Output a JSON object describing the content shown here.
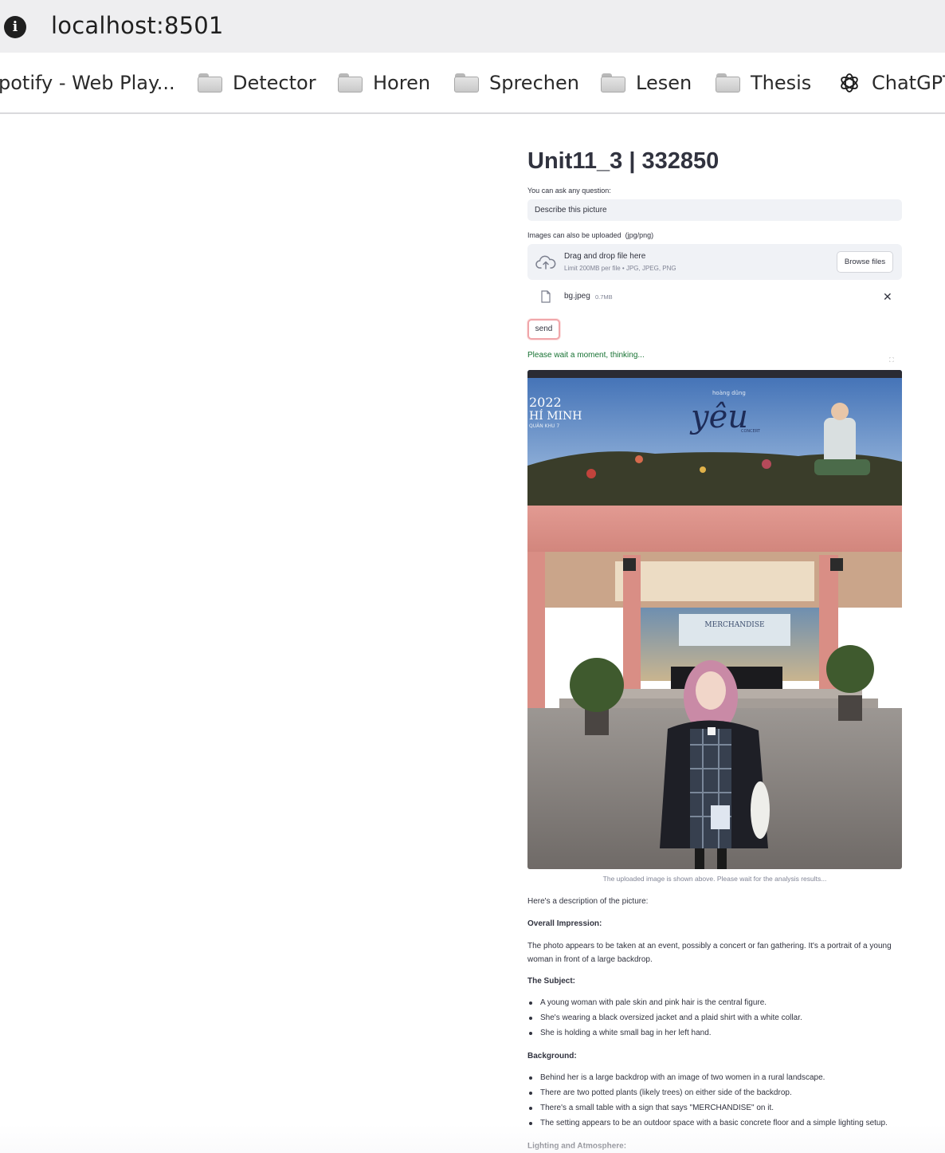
{
  "browser": {
    "url": "localhost:8501",
    "bookmarks": [
      {
        "label": "potify - Web Play...",
        "icon": "none"
      },
      {
        "label": "Detector",
        "icon": "folder-icon"
      },
      {
        "label": "Horen",
        "icon": "folder-icon"
      },
      {
        "label": "Sprechen",
        "icon": "folder-icon"
      },
      {
        "label": "Lesen",
        "icon": "folder-icon"
      },
      {
        "label": "Thesis",
        "icon": "folder-icon"
      },
      {
        "label": "ChatGPT",
        "icon": "openai-icon"
      }
    ]
  },
  "app": {
    "title": "Unit11_3 | 332850",
    "question_label": "You can ask any question:",
    "question_value": "Describe this picture",
    "upload_label": "Images can also be uploaded  (jpg/png)",
    "dropzone_title": "Drag and drop file here",
    "dropzone_limit": "Limit 200MB per file • JPG, JPEG, PNG",
    "browse_label": "Browse files",
    "file_name": "bg.jpeg",
    "file_size": "0.7MB",
    "send_label": "send",
    "status_text": "Please wait a moment, thinking...",
    "image_caption": "The uploaded image is shown above. Please wait for the analysis results...",
    "photo_text": {
      "year": "2022",
      "city": "HÍ MINH",
      "district": "QUÂN KHU 7",
      "artist": "hoàng dũng",
      "concert": "yêu",
      "subtitle": "CONCERT",
      "sign": "MERCHANDISE"
    },
    "response": {
      "intro": "Here's a description of the picture:",
      "overall_heading": "Overall Impression:",
      "overall_text": "The photo appears to be taken at an event, possibly a concert or fan gathering. It's a portrait of a young woman in front of a large backdrop.",
      "subject_heading": "The Subject:",
      "subject_items": [
        "A young woman with pale skin and pink hair is the central figure.",
        "She's wearing a black oversized jacket and a plaid shirt with a white collar.",
        "She is holding a white small bag in her left hand."
      ],
      "background_heading": "Background:",
      "background_items": [
        "Behind her is a large backdrop with an image of two women in a rural landscape.",
        "There are two potted plants (likely trees) on either side of the backdrop.",
        "There's a small table with a sign that says \"MERCHANDISE\" on it.",
        "The setting appears to be an outdoor space with a basic concrete floor and a simple lighting setup."
      ],
      "lighting_heading": "Lighting and Atmosphere:"
    }
  },
  "colors": {
    "status_green": "#177233",
    "input_bg": "#f0f2f6",
    "send_border": "#f0a6aa"
  }
}
